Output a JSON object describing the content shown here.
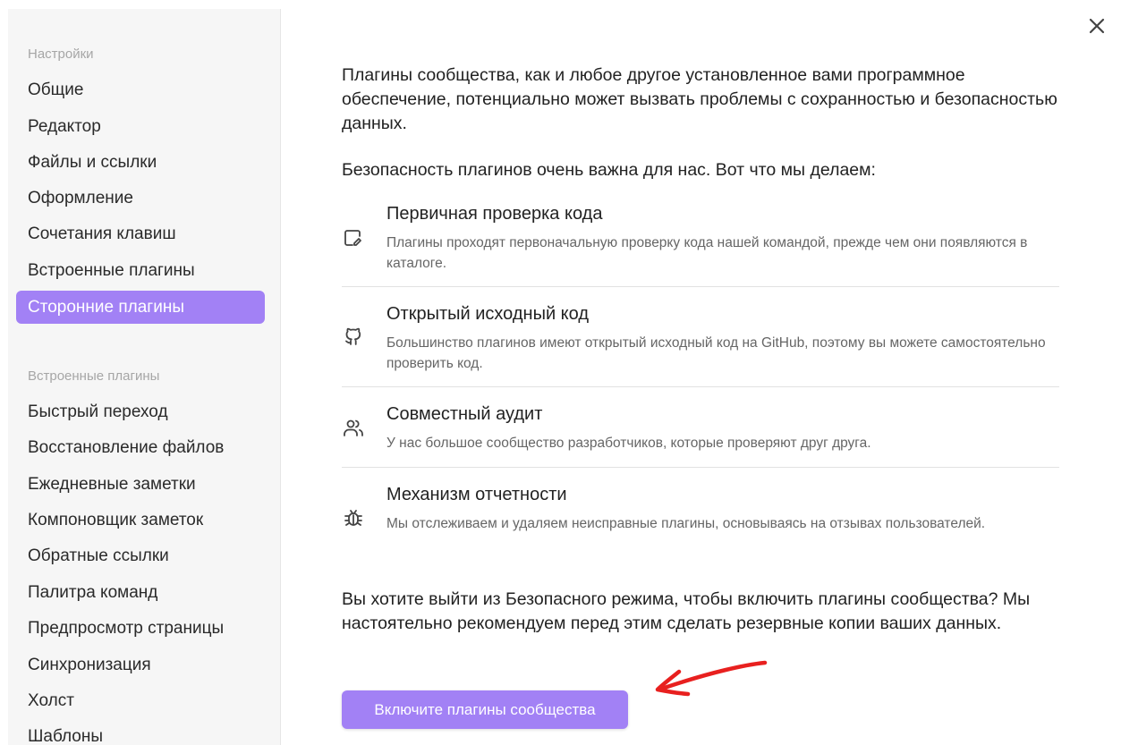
{
  "sidebar": {
    "section1_title": "Настройки",
    "section1_items": [
      "Общие",
      "Редактор",
      "Файлы и ссылки",
      "Оформление",
      "Сочетания клавиш",
      "Встроенные плагины",
      "Сторонние плагины"
    ],
    "active_index": 6,
    "section2_title": "Встроенные плагины",
    "section2_items": [
      "Быстрый переход",
      "Восстановление файлов",
      "Ежедневные заметки",
      "Компоновщик заметок",
      "Обратные ссылки",
      "Палитра команд",
      "Предпросмотр страницы",
      "Синхронизация",
      "Холст",
      "Шаблоны"
    ]
  },
  "main": {
    "intro": "Плагины сообщества, как и любое другое установленное вами программное обеспечение, потенциально может вызвать проблемы с сохранностью и безопасностью данных.",
    "security_heading": "Безопасность плагинов очень важна для нас. Вот что мы делаем:",
    "features": [
      {
        "icon": "code-review-icon",
        "title": "Первичная проверка кода",
        "desc": "Плагины проходят первоначальную проверку кода нашей командой, прежде чем они появляются в каталоге."
      },
      {
        "icon": "github-icon",
        "title": "Открытый исходный код",
        "desc": "Большинство плагинов имеют открытый исходный код на GitHub, поэтому вы можете самостоятельно проверить код."
      },
      {
        "icon": "users-icon",
        "title": "Совместный аудит",
        "desc": "У нас большое сообщество разработчиков, которые проверяют друг друга."
      },
      {
        "icon": "bug-icon",
        "title": "Механизм отчетности",
        "desc": "Мы отслеживаем и удаляем неисправные плагины, основываясь на отзывах пользователей."
      }
    ],
    "question": "Вы хотите выйти из Безопасного режима, чтобы включить плагины сообщества? Мы настоятельно рекомендуем перед этим сделать резервные копии ваших данных.",
    "enable_button": "Включите плагины сообщества"
  },
  "colors": {
    "accent": "#a281f5",
    "annotation_arrow": "#e8201f"
  }
}
